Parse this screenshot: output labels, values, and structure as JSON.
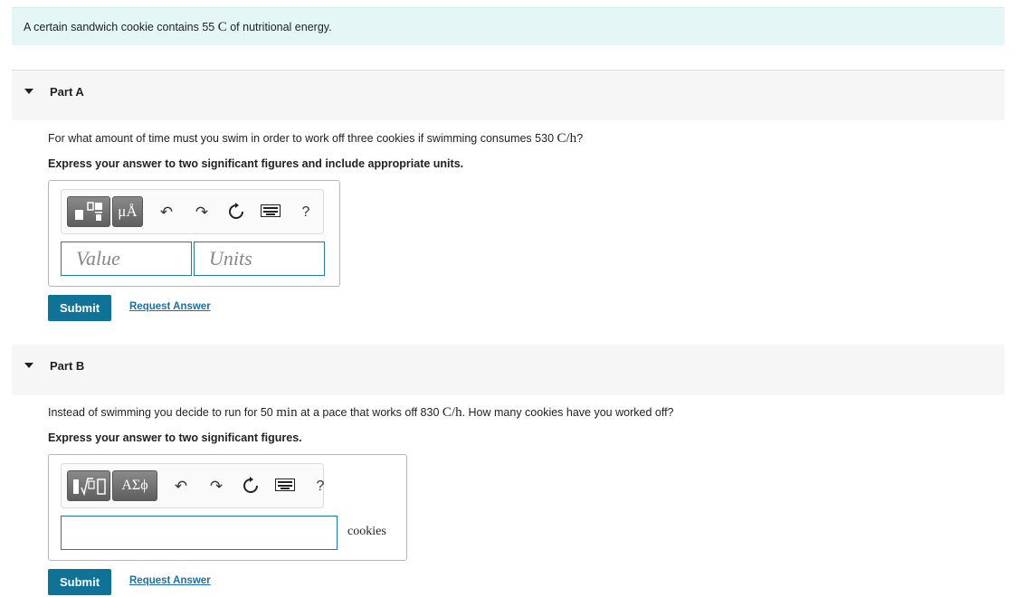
{
  "intro": {
    "pre": "A certain sandwich cookie contains 55",
    "unit": "C",
    "post": "of nutritional energy."
  },
  "part_a": {
    "title": "Part A",
    "question_pre": "For what amount of time must you swim in order to work off three cookies if swimming consumes 530",
    "question_math": "C/h",
    "question_post": "?",
    "instruction": "Express your answer to two significant figures and include appropriate units.",
    "toolbar": {
      "sym_label": "μÅ",
      "help": "?"
    },
    "value_placeholder": "Value",
    "units_placeholder": "Units",
    "submit": "Submit",
    "request": "Request Answer"
  },
  "part_b": {
    "title": "Part B",
    "question_pre": "Instead of swimming you decide to run for 50",
    "question_math1": "min",
    "question_mid": "at a pace that works off 830",
    "question_math2": "C/h",
    "question_post": ". How many cookies have you worked off?",
    "instruction": "Express your answer to two significant figures.",
    "toolbar": {
      "sym_label": "ΑΣϕ",
      "help": "?"
    },
    "answer_value": "",
    "unit_label": "cookies",
    "submit": "Submit",
    "request": "Request Answer"
  }
}
